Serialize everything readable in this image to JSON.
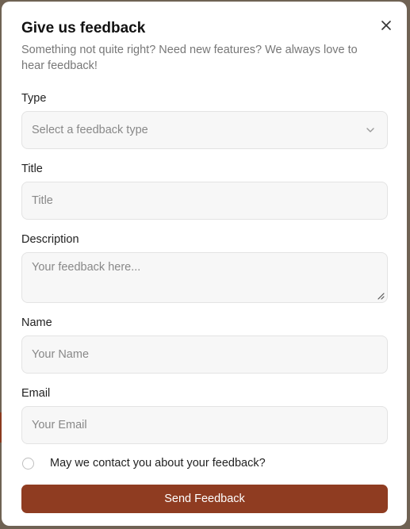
{
  "modal": {
    "title": "Give us feedback",
    "subtitle": "Something not quite right? Need new features? We always love to hear feedback!"
  },
  "form": {
    "type_label": "Type",
    "type_placeholder": "Select a feedback type",
    "title_label": "Title",
    "title_placeholder": "Title",
    "description_label": "Description",
    "description_placeholder": "Your feedback here...",
    "name_label": "Name",
    "name_placeholder": "Your Name",
    "email_label": "Email",
    "email_placeholder": "Your Email",
    "contact_label": "May we contact you about your feedback?",
    "submit_label": "Send Feedback"
  },
  "icons": {
    "close": "close-icon",
    "chevron": "chevron-down-icon"
  },
  "colors": {
    "accent": "#8f3c21",
    "input_bg": "#f7f7f7",
    "placeholder": "#888888"
  }
}
